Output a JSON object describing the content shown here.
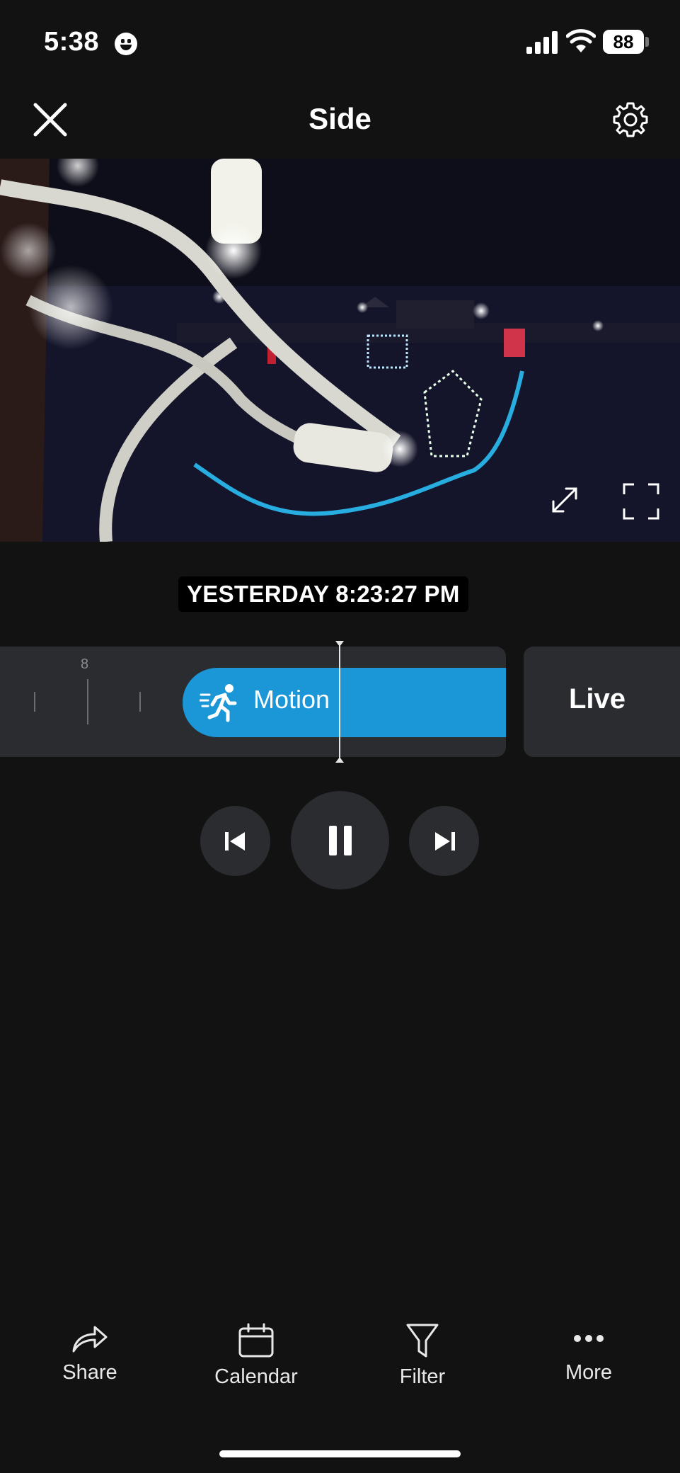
{
  "status_bar": {
    "time": "5:38",
    "battery": "88"
  },
  "header": {
    "title": "Side"
  },
  "player": {
    "timestamp": "YESTERDAY 8:23:27 PM"
  },
  "timeline": {
    "tick_label": "8",
    "event_label": "Motion",
    "event_color": "#1b96d7",
    "live_label": "Live"
  },
  "bottom_nav": {
    "items": [
      {
        "label": "Share",
        "icon": "share-icon"
      },
      {
        "label": "Calendar",
        "icon": "calendar-icon"
      },
      {
        "label": "Filter",
        "icon": "filter-icon"
      },
      {
        "label": "More",
        "icon": "more-icon"
      }
    ]
  }
}
